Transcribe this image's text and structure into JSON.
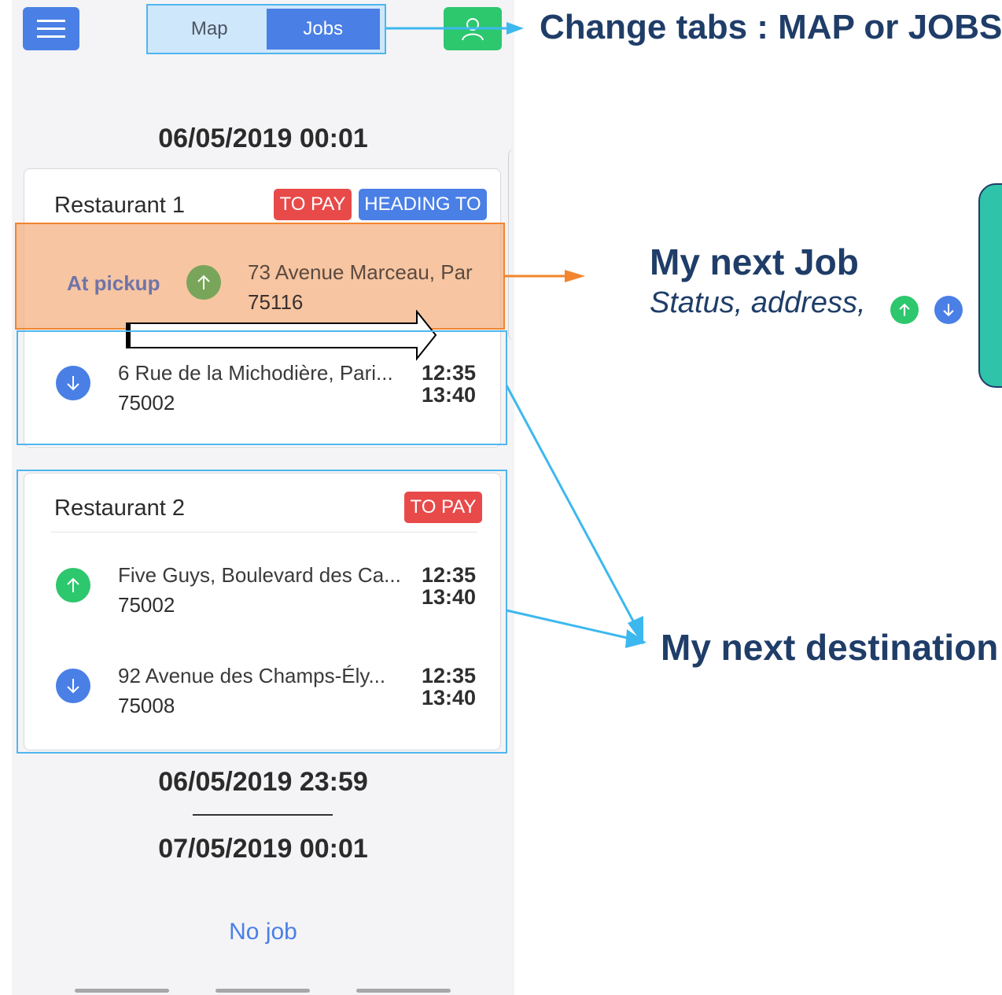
{
  "header": {
    "tabs": [
      {
        "label": "Map",
        "active": false
      },
      {
        "label": "Jobs",
        "active": true
      }
    ],
    "menu_icon": "hamburger-icon",
    "profile_icon": "user-icon"
  },
  "dates": {
    "start": "06/05/2019 00:01",
    "end": "06/05/2019 23:59",
    "next": "07/05/2019 00:01"
  },
  "job1": {
    "title": "Restaurant 1",
    "badge_pay": "TO PAY",
    "badge_status": "HEADING TO",
    "pickup": {
      "status": "At pickup",
      "address": "73 Avenue Marceau, Par",
      "zip": "75116"
    },
    "dropoff": {
      "address": "6 Rue de la Michodière, Pari...",
      "zip": "75002",
      "time_start": "12:35",
      "time_end": "13:40"
    }
  },
  "job2": {
    "title": "Restaurant 2",
    "badge_pay": "TO PAY",
    "pickup": {
      "address": "Five Guys, Boulevard des Ca...",
      "zip": "75002",
      "time_start": "12:35",
      "time_end": "13:40"
    },
    "dropoff": {
      "address": "92 Avenue des Champs-Ély...",
      "zip": "75008",
      "time_start": "12:35",
      "time_end": "13:40"
    }
  },
  "no_job": "No job",
  "annotations": {
    "tabs": "Change tabs : MAP or JOBS",
    "next_job_title": "My next Job",
    "next_job_sub": "Status, address,",
    "next_destination": "My next destination"
  },
  "colors": {
    "primary_blue": "#4a7fe6",
    "green": "#2dc76d",
    "red": "#e84a4a",
    "annotation_navy": "#1f3d68",
    "highlight_orange": "#f2852e",
    "frame_blue": "#4fb6ef"
  }
}
